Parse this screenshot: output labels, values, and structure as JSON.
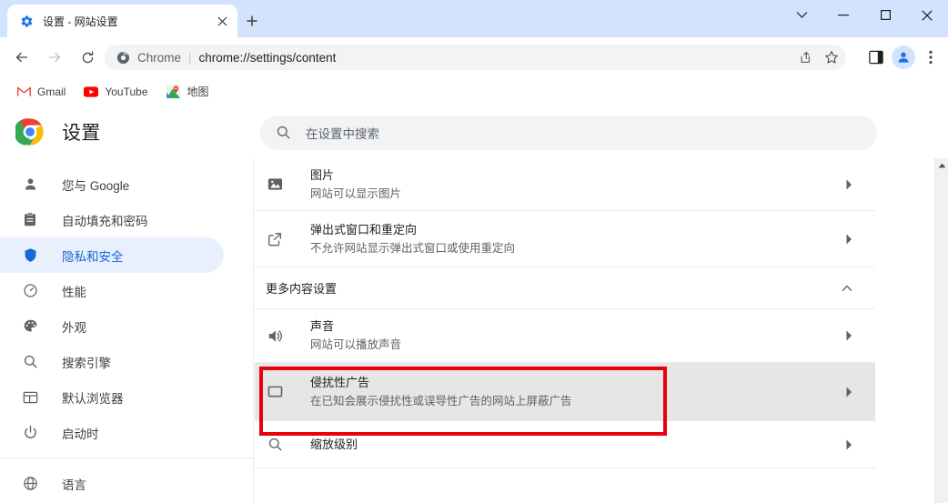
{
  "window": {
    "controls": [
      {
        "name": "tab-search",
        "glyph": "⌄"
      },
      {
        "name": "minimize",
        "glyph": "—"
      },
      {
        "name": "maximize",
        "glyph": "☐"
      },
      {
        "name": "close",
        "glyph": "✕"
      }
    ],
    "titlebar_color": "#d3e3fd"
  },
  "tab": {
    "title": "设置 - 网站设置",
    "favicon": "gear-icon",
    "close_glyph": "✕",
    "newtab_glyph": "+"
  },
  "toolbar": {
    "back_glyph": "←",
    "forward_glyph": "→",
    "reload_glyph": "⟳",
    "omnibox": {
      "chrome_label": "Chrome",
      "separator": "|",
      "url": "chrome://settings/content",
      "share_icon": "share-icon",
      "bookmark_icon": "star-icon"
    },
    "side_panel_icon": "side-panel-icon",
    "profile_icon": "avatar-icon",
    "menu_glyph": "⋮"
  },
  "bookmarks": [
    {
      "label": "Gmail",
      "icon": "gmail-icon"
    },
    {
      "label": "YouTube",
      "icon": "youtube-icon"
    },
    {
      "label": "地图",
      "icon": "maps-icon"
    }
  ],
  "settings": {
    "title": "设置",
    "logo": "chrome-logo",
    "search": {
      "placeholder": "在设置中搜索",
      "icon": "search-icon",
      "value": ""
    },
    "sidebar": {
      "items": [
        {
          "label": "您与 Google",
          "icon": "person-icon",
          "active": false
        },
        {
          "label": "自动填充和密码",
          "icon": "clipboard-icon",
          "active": false
        },
        {
          "label": "隐私和安全",
          "icon": "shield-icon",
          "active": true
        },
        {
          "label": "性能",
          "icon": "speed-icon",
          "active": false
        },
        {
          "label": "外观",
          "icon": "palette-icon",
          "active": false
        },
        {
          "label": "搜索引擎",
          "icon": "search-icon",
          "active": false
        },
        {
          "label": "默认浏览器",
          "icon": "browser-icon",
          "active": false
        },
        {
          "label": "启动时",
          "icon": "power-icon",
          "active": false
        },
        {
          "label": "语言",
          "icon": "globe-icon",
          "active": false
        }
      ],
      "active_color": "#1967d2",
      "active_bg": "#e8f0fe"
    },
    "content_rows": [
      {
        "title": "图片",
        "subtitle": "网站可以显示图片",
        "icon": "image-icon",
        "chevron": "▸",
        "hovered": false
      },
      {
        "title": "弹出式窗口和重定向",
        "subtitle": "不允许网站显示弹出式窗口或使用重定向",
        "icon": "popup-icon",
        "chevron": "▸",
        "hovered": false
      }
    ],
    "section": {
      "label": "更多内容设置",
      "chevron": "⌃",
      "expanded": true
    },
    "section_rows": [
      {
        "title": "声音",
        "subtitle": "网站可以播放声音",
        "icon": "sound-icon",
        "chevron": "▸",
        "hovered": false
      },
      {
        "title": "侵扰性广告",
        "subtitle": "在已知会展示侵扰性或误导性广告的网站上屏蔽广告",
        "icon": "ads-icon",
        "chevron": "▸",
        "hovered": true
      },
      {
        "title": "缩放级别",
        "subtitle": "",
        "icon": "zoom-icon",
        "chevron": "▸",
        "hovered": false
      }
    ],
    "scrollbar": {
      "up_arrow": "▲"
    },
    "annotation": {
      "color": "#e8000d",
      "target": "侵扰性广告"
    }
  }
}
